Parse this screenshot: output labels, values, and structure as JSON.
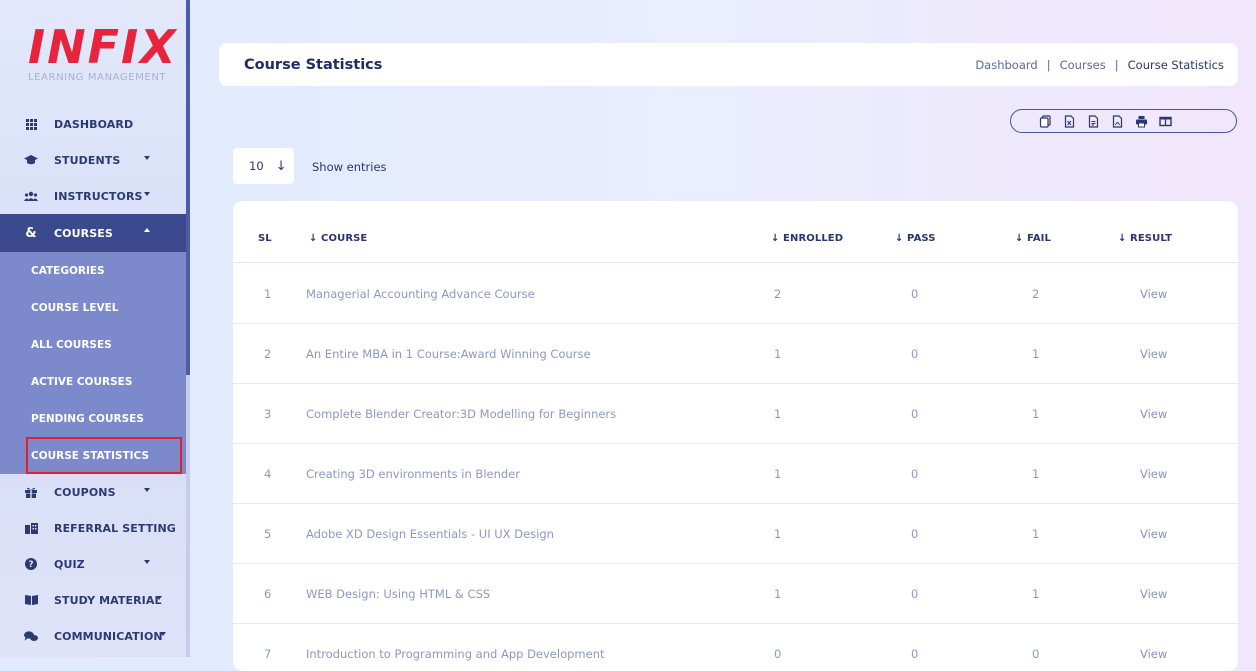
{
  "brand": {
    "logo_text": "INFIX",
    "subtitle": "LEARNING MANAGEMENT"
  },
  "colors": {
    "accent": "#3b4a8f",
    "submenu": "#7c8acc",
    "logo": "#e8233e",
    "highlight": "#e21f2f"
  },
  "sidebar": {
    "items": [
      {
        "label": "DASHBOARD",
        "icon": "grid-icon"
      },
      {
        "label": "STUDENTS",
        "icon": "graduation-cap-icon"
      },
      {
        "label": "INSTRUCTORS",
        "icon": "users-icon"
      },
      {
        "label": "COURSES",
        "icon": "ampersand-icon"
      },
      {
        "label": "COUPONS",
        "icon": "gift-icon"
      },
      {
        "label": "REFERRAL SETTING",
        "icon": "building-icon"
      },
      {
        "label": "QUIZ",
        "icon": "question-icon"
      },
      {
        "label": "STUDY MATERIAL",
        "icon": "book-icon"
      },
      {
        "label": "COMMUNICATION",
        "icon": "chat-icon"
      }
    ],
    "courses_submenu": [
      "CATEGORIES",
      "COURSE LEVEL",
      "ALL COURSES",
      "ACTIVE COURSES",
      "PENDING COURSES",
      "COURSE STATISTICS"
    ]
  },
  "header": {
    "title": "Course Statistics",
    "breadcrumb": [
      "Dashboard",
      "Courses",
      "Course Statistics"
    ],
    "separator": "|"
  },
  "export_buttons": [
    "copy-icon",
    "csv-icon",
    "excel-icon",
    "pdf-icon",
    "print-icon",
    "columns-icon"
  ],
  "entries": {
    "value": "10",
    "label": "Show entries"
  },
  "table": {
    "columns": [
      "SL",
      "↓ COURSE",
      "↓ ENROLLED",
      "↓ PASS",
      "↓ FAIL",
      "↓ RESULT"
    ],
    "rows": [
      {
        "sl": "1",
        "course": "Managerial Accounting Advance Course",
        "enrolled": "2",
        "pass": "0",
        "fail": "2",
        "result": "View"
      },
      {
        "sl": "2",
        "course": "An Entire MBA in 1 Course:Award Winning Course",
        "enrolled": "1",
        "pass": "0",
        "fail": "1",
        "result": "View"
      },
      {
        "sl": "3",
        "course": "Complete Blender Creator:3D Modelling for Beginners",
        "enrolled": "1",
        "pass": "0",
        "fail": "1",
        "result": "View"
      },
      {
        "sl": "4",
        "course": "Creating 3D environments in Blender",
        "enrolled": "1",
        "pass": "0",
        "fail": "1",
        "result": "View"
      },
      {
        "sl": "5",
        "course": "Adobe XD Design Essentials - UI UX Design",
        "enrolled": "1",
        "pass": "0",
        "fail": "1",
        "result": "View"
      },
      {
        "sl": "6",
        "course": "WEB Design: Using HTML & CSS",
        "enrolled": "1",
        "pass": "0",
        "fail": "1",
        "result": "View"
      },
      {
        "sl": "7",
        "course": "Introduction to Programming and App Development",
        "enrolled": "0",
        "pass": "0",
        "fail": "0",
        "result": "View"
      }
    ]
  }
}
